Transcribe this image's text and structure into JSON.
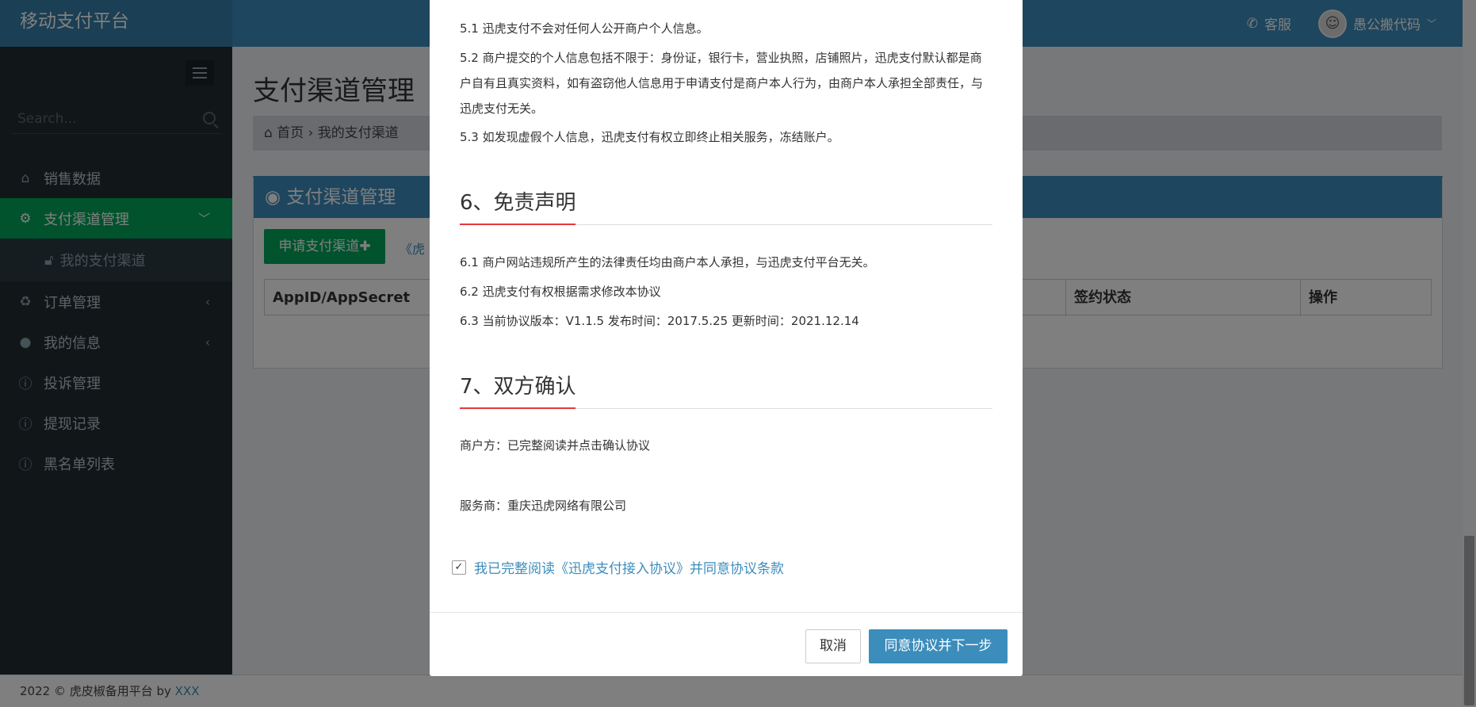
{
  "navbar": {
    "brand": "移动支付平台",
    "support_label": "客服",
    "user_name": "愚公搬代码"
  },
  "sidebar": {
    "search_placeholder": "Search...",
    "items": [
      {
        "label": "销售数据",
        "icon": "home-icon"
      },
      {
        "label": "支付渠道管理",
        "icon": "cogs-icon",
        "active": true
      },
      {
        "label": "我的支付渠道",
        "icon": "lock-icon",
        "sub": true
      },
      {
        "label": "订单管理",
        "icon": "recycle-icon"
      },
      {
        "label": "我的信息",
        "icon": "user-icon"
      },
      {
        "label": "投诉管理",
        "icon": "info-icon"
      },
      {
        "label": "提现记录",
        "icon": "info-icon"
      },
      {
        "label": "黑名单列表",
        "icon": "info-icon"
      }
    ]
  },
  "content": {
    "page_title": "支付渠道管理",
    "breadcrumb_home": "首页",
    "breadcrumb_current": "我的支付渠道",
    "box_title": "支付渠道管理",
    "apply_button": "申请支付渠道✚",
    "link_text": "《虎",
    "columns": [
      "AppID/AppSecret",
      "签约状态",
      "操作"
    ]
  },
  "footer": {
    "text": "2022 © 虎皮椒备用平台 by ",
    "link": "XXX"
  },
  "modal": {
    "p5_1": "5.1 迅虎支付不会对任何人公开商户个人信息。",
    "p5_2": "5.2 商户提交的个人信息包括不限于：身份证，银行卡，营业执照，店铺照片，迅虎支付默认都是商户自有且真实资料，如有盗窃他人信息用于申请支付是商户本人行为，由商户本人承担全部责任，与迅虎支付无关。",
    "p5_3": "5.3 如发现虚假个人信息，迅虎支付有权立即终止相关服务，冻结账户。",
    "section6": "6、免责声明",
    "p6_1": "6.1 商户网站违规所产生的法律责任均由商户本人承担，与迅虎支付平台无关。",
    "p6_2": "6.2 迅虎支付有权根据需求修改本协议",
    "p6_3": "6.3 当前协议版本：V1.1.5 发布时间：2017.5.25 更新时间：2021.12.14",
    "section7": "7、双方确认",
    "merchant": "商户方：已完整阅读并点击确认协议",
    "provider": "服务商：重庆迅虎网络有限公司",
    "agree_label": "我已完整阅读《迅虎支付接入协议》并同意协议条款",
    "cancel_button": "取消",
    "ok_button": "同意协议并下一步"
  },
  "colors": {
    "navbar": "#3c8dbc",
    "sidebar": "#222d32",
    "active": "#00a65a",
    "accent_rule": "#e4393c"
  }
}
